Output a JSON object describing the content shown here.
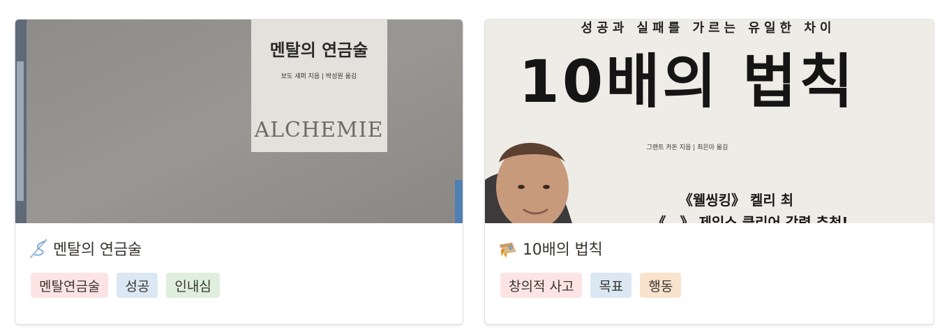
{
  "cards": [
    {
      "icon": "needle-and-thread-icon",
      "title": "멘탈의 연금술",
      "cover": {
        "book_title": "멘탈의 연금술",
        "byline": "보도 섀퍼 지음 | 박성원 옮김",
        "english": "ALCHEMIE"
      },
      "tags": [
        {
          "label": "멘탈연금술",
          "color": "#fde4e4"
        },
        {
          "label": "성공",
          "color": "#dbe7f3"
        },
        {
          "label": "인내심",
          "color": "#dfeedd"
        }
      ]
    },
    {
      "icon": "rocket-icon",
      "title": "10배의 법칙",
      "cover": {
        "subtitle": "성공과 실패를 가르는 유일한 차이",
        "book_title": "10배의 법칙",
        "byline": "그랜트 카돈 지음 | 최은아 옮김",
        "blurb": "《웰씽킹》 켈리 최",
        "blurb2": "《…》 제임스 클리어 강력 추천!"
      },
      "tags": [
        {
          "label": "창의적 사고",
          "color": "#fde4e4"
        },
        {
          "label": "목표",
          "color": "#dbe7f3"
        },
        {
          "label": "행동",
          "color": "#fae3cd"
        }
      ]
    }
  ]
}
